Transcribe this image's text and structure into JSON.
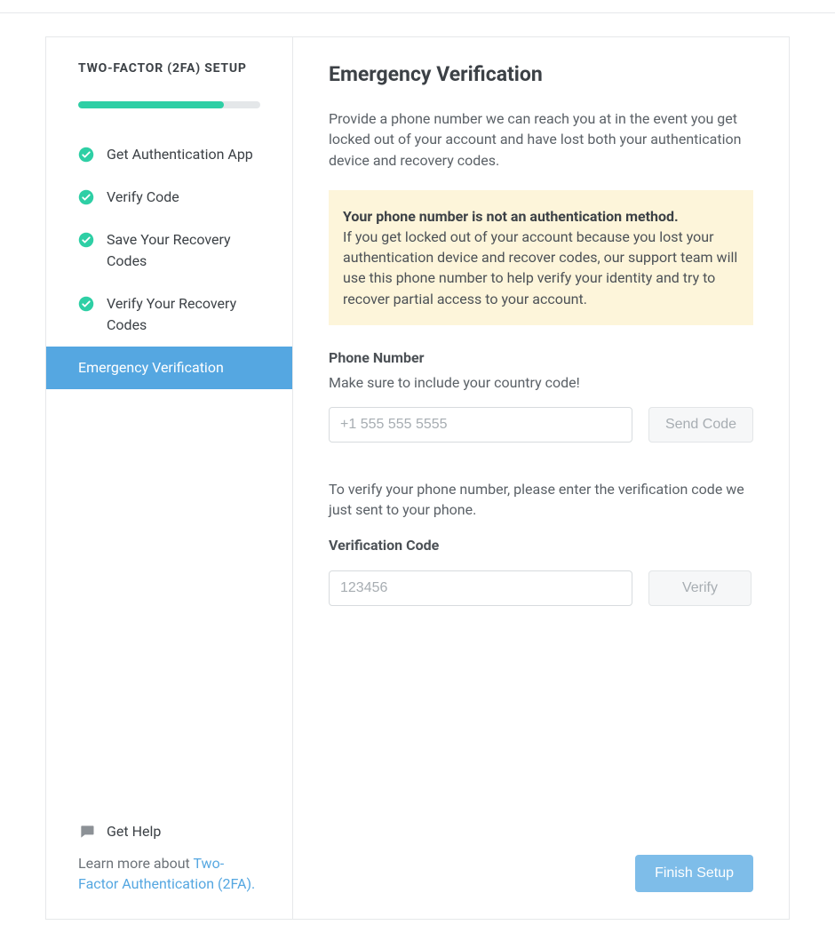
{
  "colors": {
    "accent_green": "#2ecfa5",
    "accent_blue": "#55a7e1",
    "callout_bg": "#fdf5da"
  },
  "sidebar": {
    "title": "TWO-FACTOR (2FA) SETUP",
    "progress_percent": 80,
    "steps": [
      {
        "label": "Get Authentication App",
        "done": true,
        "active": false
      },
      {
        "label": "Verify Code",
        "done": true,
        "active": false
      },
      {
        "label": "Save Your Recovery Codes",
        "done": true,
        "active": false
      },
      {
        "label": "Verify Your Recovery Codes",
        "done": true,
        "active": false
      },
      {
        "label": "Emergency Verification",
        "done": false,
        "active": true
      }
    ],
    "help": {
      "label": "Get Help",
      "learn_prefix": "Learn more about ",
      "learn_link_text": "Two-Factor Authentication (2FA)."
    }
  },
  "main": {
    "title": "Emergency Verification",
    "intro": "Provide a phone number we can reach you at in the event you get locked out of your account and have lost both your authentication device and recovery codes.",
    "callout_bold": "Your phone number is not an authentication method.",
    "callout_body": "If you get locked out of your account because you lost your authentication device and recover codes, our support team will use this phone number to help verify your identity and try to recover partial access to your account.",
    "phone": {
      "label": "Phone Number",
      "hint": "Make sure to include your country code!",
      "placeholder": "+1 555 555 5555",
      "value": "",
      "send_button": "Send Code"
    },
    "verify_intro": "To verify your phone number, please enter the verification code we just sent to your phone.",
    "code": {
      "label": "Verification Code",
      "placeholder": "123456",
      "value": "",
      "verify_button": "Verify"
    },
    "finish_button": "Finish Setup"
  }
}
